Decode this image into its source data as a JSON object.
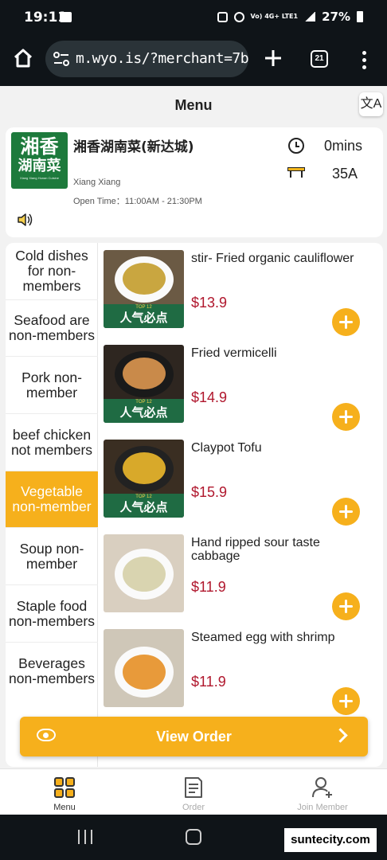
{
  "status_bar": {
    "time": "19:11",
    "network": "Vo) 4G+ LTE1",
    "battery": "27%"
  },
  "browser": {
    "url": "m.wyo.is/?merchant=7b",
    "tab_count": "21"
  },
  "header": {
    "title": "Menu",
    "translate_glyph": "文A"
  },
  "store": {
    "logo_line1": "湘香",
    "logo_line2": "湖南菜",
    "logo_line3": "Xiang Xiang Hunan Cuisine",
    "name": "湘香湖南菜(新达城)",
    "subtitle": "Xiang Xiang",
    "hours": "Open Time：11:00AM - 21:30PM",
    "wait_time": "0mins",
    "table": "35A"
  },
  "categories": [
    {
      "label": "Cold dishes for non-members",
      "active": false
    },
    {
      "label": "Seafood are non-members",
      "active": false
    },
    {
      "label": "Pork non-member",
      "active": false
    },
    {
      "label": "beef chicken not members",
      "active": false
    },
    {
      "label": "Vegetable non-member",
      "active": true
    },
    {
      "label": "Soup non-member",
      "active": false
    },
    {
      "label": "Staple food non-members",
      "active": false
    },
    {
      "label": "Beverages non-members",
      "active": false
    }
  ],
  "dishes": [
    {
      "name": "stir- Fried organic cauliflower",
      "price": "$13.9",
      "badge": "人气必点",
      "badge_top": "TOP 12",
      "food_color": "#c9a640"
    },
    {
      "name": "Fried vermicelli",
      "price": "$14.9",
      "badge": "人气必点",
      "badge_top": "TOP 12",
      "food_color": "#c98a4a"
    },
    {
      "name": "Claypot Tofu",
      "price": "$15.9",
      "badge": "人气必点",
      "badge_top": "TOP 12",
      "food_color": "#d8a92a"
    },
    {
      "name": "Hand ripped sour taste cabbage",
      "price": "$11.9",
      "badge": "",
      "badge_top": "",
      "food_color": "#d9d4b0"
    },
    {
      "name": "Steamed egg with shrimp",
      "price": "$11.9",
      "badge": "",
      "badge_top": "",
      "food_color": "#e89a3a"
    }
  ],
  "view_order": {
    "label": "View Order"
  },
  "bottom_nav": [
    {
      "label": "Menu",
      "icon": "grid-icon",
      "active": true
    },
    {
      "label": "Order",
      "icon": "document-icon",
      "active": false
    },
    {
      "label": "Join Member",
      "icon": "person-add-icon",
      "active": false
    }
  ],
  "watermark": "suntecity.com",
  "colors": {
    "accent": "#f6b01c",
    "price": "#b0172d",
    "chrome": "#0f1418",
    "logo_green": "#1d7a3c"
  }
}
